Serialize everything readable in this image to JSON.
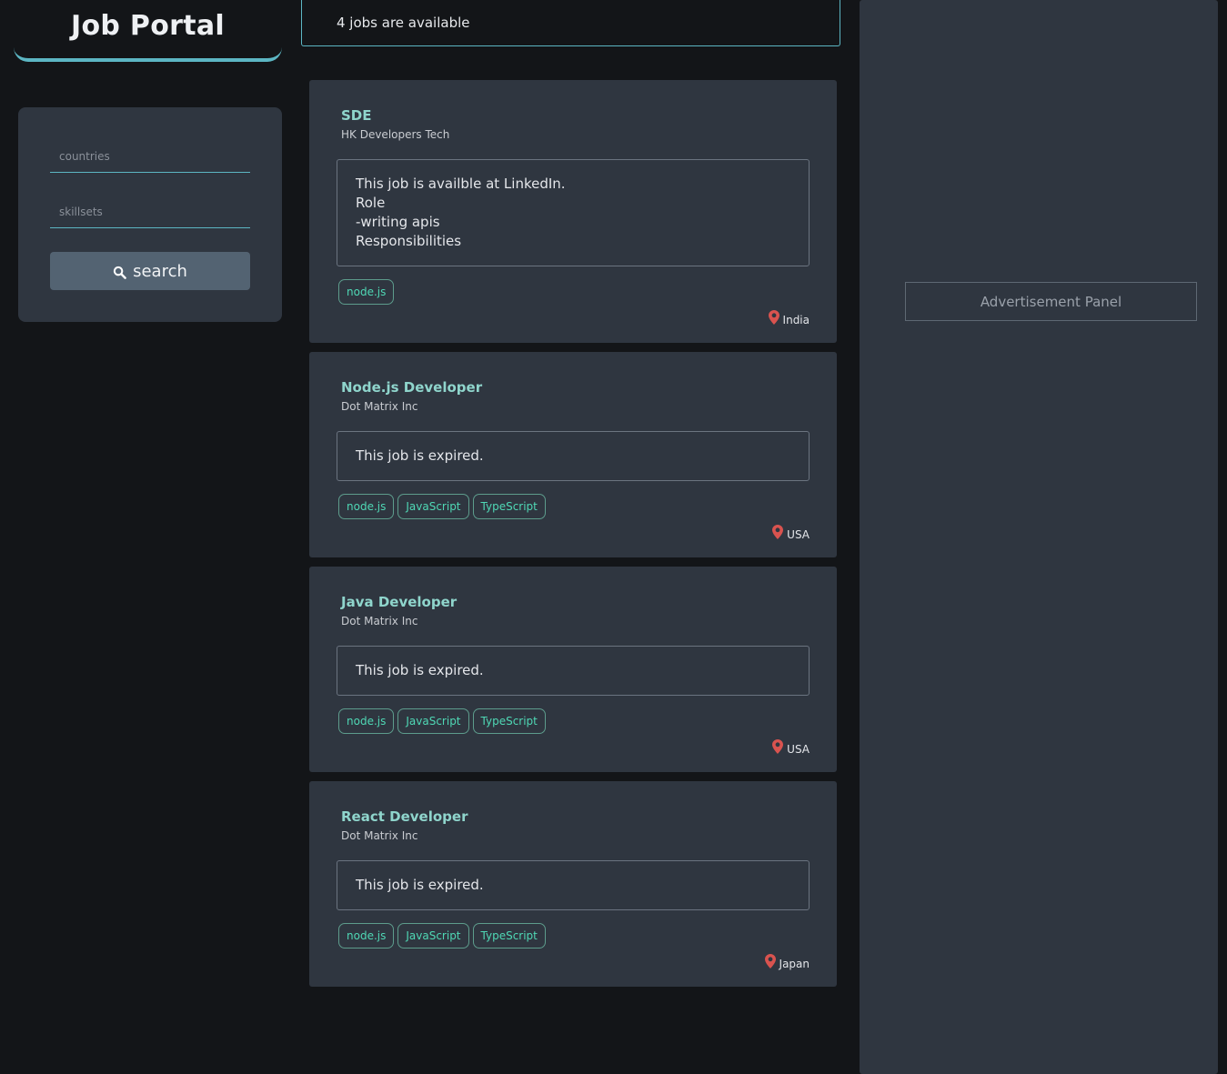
{
  "brand": {
    "title": "Job Portal"
  },
  "search": {
    "countries_placeholder": "countries",
    "countries_value": "",
    "skills_placeholder": "skillsets",
    "skills_value": "",
    "button_label": "search"
  },
  "jobs_count_text": "4 jobs are available",
  "jobs": [
    {
      "title": "SDE",
      "company": "HK Developers Tech",
      "description": "This job is availble at LinkedIn.\nRole\n-writing apis\nResponsibilities",
      "tags": [
        "node.js"
      ],
      "location": "India"
    },
    {
      "title": "Node.js Developer",
      "company": "Dot Matrix Inc",
      "description": "This job is expired.",
      "tags": [
        "node.js",
        "JavaScript",
        "TypeScript"
      ],
      "location": "USA"
    },
    {
      "title": "Java Developer",
      "company": "Dot Matrix Inc",
      "description": "This job is expired.",
      "tags": [
        "node.js",
        "JavaScript",
        "TypeScript"
      ],
      "location": "USA"
    },
    {
      "title": "React Developer",
      "company": "Dot Matrix Inc",
      "description": "This job is expired.",
      "tags": [
        "node.js",
        "JavaScript",
        "TypeScript"
      ],
      "location": "Japan"
    }
  ],
  "ad": {
    "label": "Advertisement Panel"
  },
  "icons": {
    "search": "search-icon",
    "location": "map-pin-icon"
  },
  "colors": {
    "accent": "#5cb6c3",
    "job_title": "#8fd5cc",
    "tag_text": "#4fd8b5",
    "pin": "#d9534f",
    "panel": "#2f3640",
    "background": "#131518"
  }
}
